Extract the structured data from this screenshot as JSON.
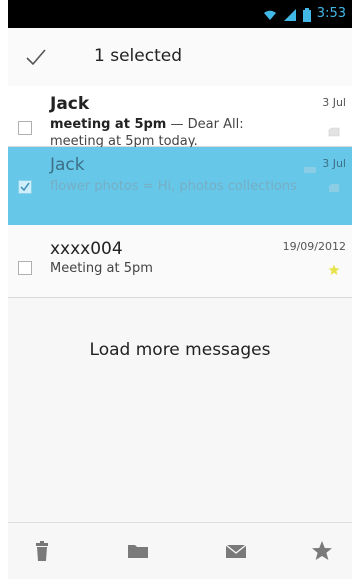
{
  "status_bar": {
    "time": "3:53",
    "icons": [
      "wifi-icon",
      "signal-icon",
      "battery-icon"
    ]
  },
  "action_bar": {
    "title": "1 selected",
    "done_icon": "checkmark-icon"
  },
  "messages": [
    {
      "sender": "Jack",
      "date": "3 Jul",
      "subject": "meeting at 5pm",
      "separator": "—",
      "preview": "Dear All: meeting at 5pm today.",
      "selected": false,
      "has_attachment": true,
      "starred": false
    },
    {
      "sender": "Jack",
      "date": "3 Jul",
      "subject": "flower photos",
      "separator": "=",
      "preview": "Hi, photos collections–",
      "selected": true,
      "has_attachment": true,
      "starred": false
    },
    {
      "sender": "xxxx004",
      "date": "19/09/2012",
      "subject": "Meeting at 5pm",
      "preview": "",
      "selected": false,
      "has_attachment": false,
      "starred": true
    }
  ],
  "load_more": "Load more messages",
  "bottom_bar": [
    "delete-icon",
    "move-to-folder-icon",
    "mark-read-icon",
    "star-icon"
  ],
  "colors": {
    "accent": "#33b5e5",
    "selected_row": "#66c7e9",
    "star": "#e6e24a",
    "clock": "#42b8e6"
  }
}
